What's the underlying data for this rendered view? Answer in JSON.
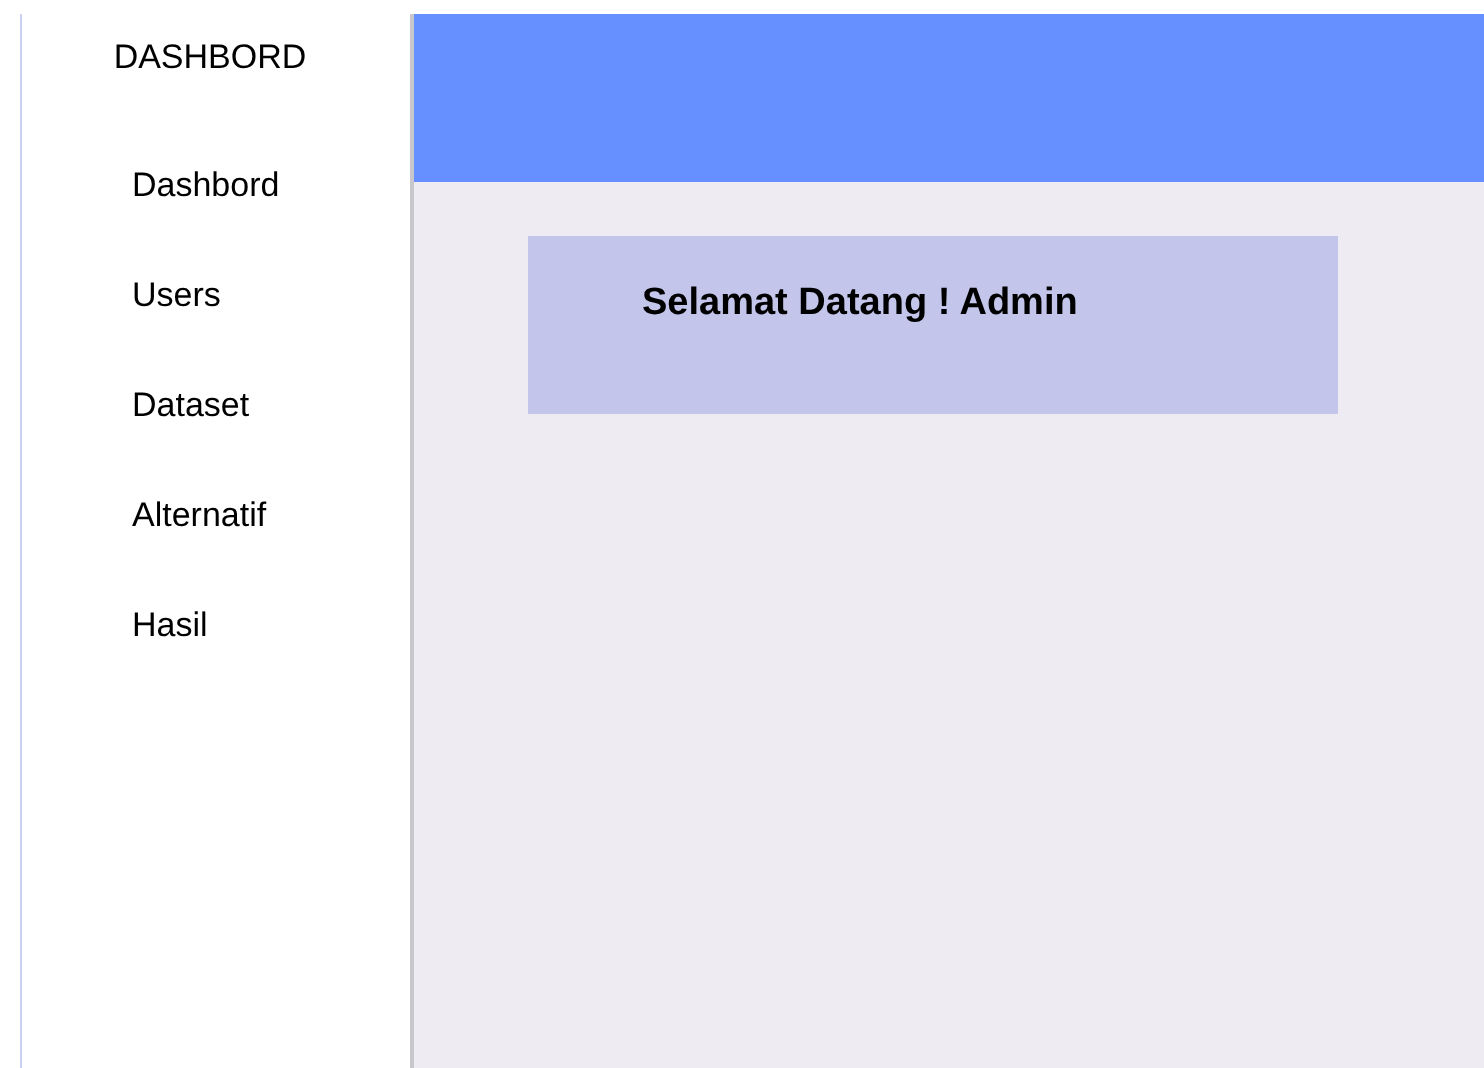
{
  "sidebar": {
    "title": "DASHBORD",
    "items": [
      {
        "label": "Dashbord"
      },
      {
        "label": "Users"
      },
      {
        "label": "Dataset"
      },
      {
        "label": "Alternatif"
      },
      {
        "label": "Hasil"
      }
    ]
  },
  "welcome_card": {
    "text": "Selamat Datang ! Admin"
  }
}
